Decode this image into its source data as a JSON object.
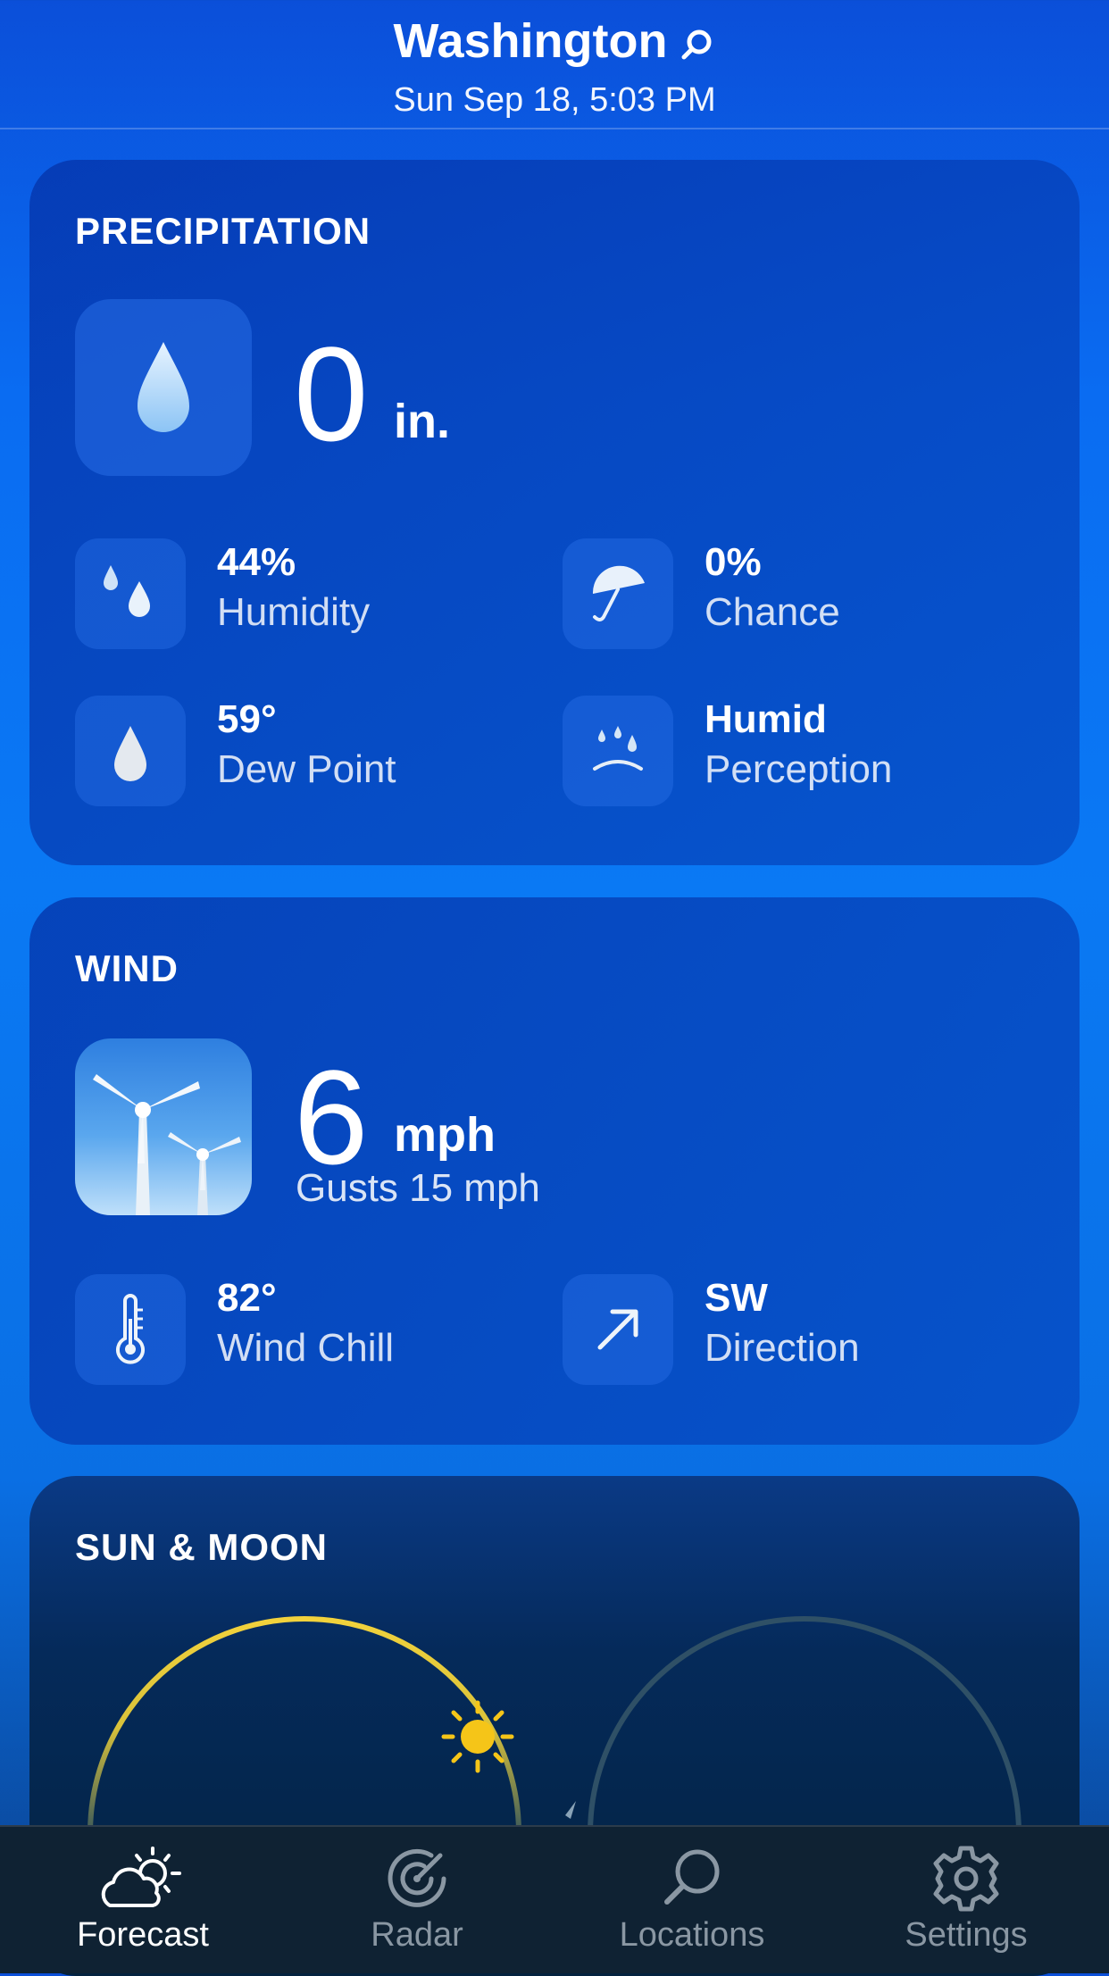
{
  "header": {
    "city": "Washington",
    "datetime": "Sun Sep 18, 5:03 PM"
  },
  "precipitation": {
    "title": "PRECIPITATION",
    "amount": "0",
    "unit": "in.",
    "stats": [
      {
        "value": "44%",
        "label": "Humidity",
        "icon": "droplets-icon"
      },
      {
        "value": "0%",
        "label": "Chance",
        "icon": "umbrella-icon"
      },
      {
        "value": "59°",
        "label": "Dew Point",
        "icon": "droplet-icon"
      },
      {
        "value": "Humid",
        "label": "Perception",
        "icon": "sweat-face-icon"
      }
    ]
  },
  "wind": {
    "title": "WIND",
    "speed": "6",
    "unit": "mph",
    "gusts": "Gusts 15 mph",
    "stats": [
      {
        "value": "82°",
        "label": "Wind Chill",
        "icon": "thermometer-icon"
      },
      {
        "value": "SW",
        "label": "Direction",
        "icon": "arrow-up-right-icon"
      }
    ]
  },
  "sun_moon": {
    "title": "SUN & MOON"
  },
  "tabs": [
    {
      "label": "Forecast",
      "icon": "partly-cloudy-icon",
      "active": true
    },
    {
      "label": "Radar",
      "icon": "radar-icon",
      "active": false
    },
    {
      "label": "Locations",
      "icon": "search-icon",
      "active": false
    },
    {
      "label": "Settings",
      "icon": "gear-icon",
      "active": false
    }
  ],
  "colors": {
    "sun_arc": "#f2d23c",
    "tab_active": "#ffffff",
    "tab_inactive": "#8a97a3"
  }
}
